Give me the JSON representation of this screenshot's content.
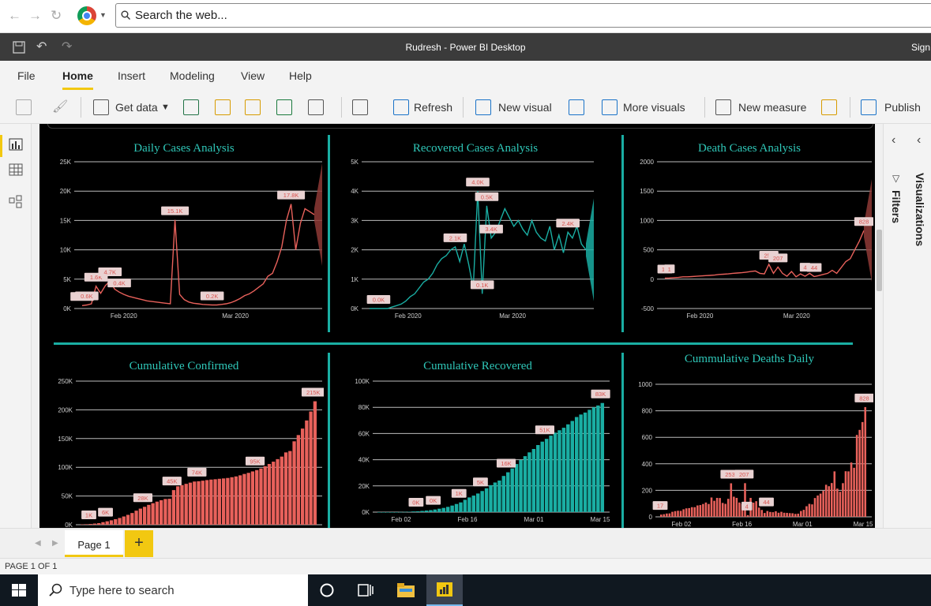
{
  "browser": {
    "search_placeholder": "Search the web..."
  },
  "window": {
    "title": "Rudresh - Power BI Desktop",
    "sign_in": "Sign"
  },
  "menu": [
    "File",
    "Home",
    "Insert",
    "Modeling",
    "View",
    "Help"
  ],
  "toolbar": {
    "get_data": "Get data",
    "refresh": "Refresh",
    "new_visual": "New visual",
    "more_visuals": "More visuals",
    "new_measure": "New measure",
    "publish": "Publish"
  },
  "panes": {
    "filters": "Filters",
    "visualizations": "Visualizations"
  },
  "pages": {
    "page1": "Page 1",
    "add": "+",
    "status": "PAGE 1 OF 1"
  },
  "taskbar": {
    "search": "Type here to search"
  },
  "colors": {
    "red": "#e8615b",
    "teal": "#1aaea3",
    "title": "#2fc7b8"
  },
  "chart_data": [
    {
      "type": "line",
      "title": "Daily Cases Analysis",
      "yticks": [
        "0K",
        "5K",
        "10K",
        "15K",
        "20K",
        "25K"
      ],
      "ylim": [
        0,
        25000
      ],
      "xticks": [
        "Feb 2020",
        "Mar 2020"
      ],
      "values": [
        500,
        600,
        800,
        3800,
        2600,
        3900,
        4700,
        3300,
        2800,
        2400,
        2100,
        1900,
        1700,
        1500,
        1300,
        1200,
        1100,
        1000,
        900,
        800,
        15100,
        2400,
        1500,
        1100,
        900,
        800,
        700,
        650,
        600,
        600,
        700,
        800,
        1000,
        1300,
        1700,
        2200,
        2500,
        3000,
        3600,
        4200,
        5500,
        6000,
        8000,
        10500,
        15000,
        17800,
        10000,
        14500,
        17000,
        16500,
        16000
      ],
      "labels": [
        "0.6K",
        "0.6K",
        "1.6K",
        "4.7K",
        "15.1K",
        "0.4K",
        "0.2K",
        "17.8K"
      ],
      "color": "#e8615b"
    },
    {
      "type": "line",
      "title": "Recovered Cases Analysis",
      "yticks": [
        "0K",
        "1K",
        "2K",
        "3K",
        "4K",
        "5K"
      ],
      "ylim": [
        0,
        5000
      ],
      "xticks": [
        "Feb 2020",
        "Mar 2020"
      ],
      "values": [
        0,
        0,
        0,
        0,
        0,
        50,
        100,
        150,
        250,
        400,
        500,
        700,
        900,
        1000,
        1200,
        1500,
        1700,
        1800,
        2000,
        2100,
        1600,
        2200,
        1500,
        700,
        4000,
        500,
        3500,
        2400,
        2600,
        3000,
        3400,
        3100,
        2800,
        3000,
        2700,
        2500,
        3000,
        2600,
        2400,
        2300,
        2800,
        2000,
        2500,
        1900,
        2600,
        2400,
        2800,
        2200,
        2000
      ],
      "labels": [
        "0.0K",
        "2.1K",
        "4.0K",
        "3.4K",
        "0.1K",
        "0.5K",
        "2.4K"
      ],
      "color": "#1aaea3"
    },
    {
      "type": "line",
      "title": "Death Cases Analysis",
      "yticks": [
        "-500",
        "0",
        "500",
        "1000",
        "1500",
        "2000"
      ],
      "ylim": [
        -500,
        2000
      ],
      "xticks": [
        "Feb 2020",
        "Mar 2020"
      ],
      "values": [
        17,
        20,
        25,
        30,
        40,
        40,
        45,
        50,
        55,
        60,
        65,
        70,
        80,
        85,
        90,
        100,
        105,
        110,
        120,
        130,
        140,
        100,
        90,
        253,
        100,
        207,
        100,
        50,
        130,
        40,
        90,
        50,
        100,
        44,
        60,
        80,
        100,
        150,
        100,
        200,
        300,
        350,
        500,
        650,
        828
      ],
      "labels": [
        "17",
        "1",
        "253",
        "207",
        "4",
        "44",
        "828"
      ],
      "color": "#e8615b"
    },
    {
      "type": "bar",
      "title": "Cumulative Confirmed",
      "yticks": [
        "0K",
        "50K",
        "100K",
        "150K",
        "200K",
        "250K"
      ],
      "ylim": [
        0,
        250000
      ],
      "values": [
        600,
        900,
        1300,
        2000,
        2800,
        4500,
        6000,
        7700,
        9700,
        11800,
        14400,
        17200,
        20400,
        24500,
        28100,
        31200,
        34600,
        37500,
        40200,
        42700,
        44800,
        45200,
        60300,
        66900,
        69000,
        71200,
        73300,
        75200,
        75700,
        76700,
        77700,
        78600,
        79200,
        80000,
        80600,
        81400,
        82700,
        84100,
        86000,
        88400,
        90300,
        92800,
        95100,
        97900,
        101800,
        105800,
        109800,
        114200,
        118600,
        125900,
        128300,
        145200,
        156100,
        167400,
        181500,
        197100,
        214900
      ],
      "labels": [
        "1K",
        "6K",
        "28K",
        "45K",
        "74K",
        "95K",
        "215K"
      ],
      "color": "#e8615b"
    },
    {
      "type": "bar",
      "title": "Cumulative Recovered",
      "yticks": [
        "0K",
        "20K",
        "40K",
        "60K",
        "80K",
        "100K"
      ],
      "ylim": [
        0,
        100000
      ],
      "xticks": [
        "Feb 02",
        "Feb 16",
        "Mar 01",
        "Mar 15"
      ],
      "values": [
        0,
        0,
        0,
        0,
        0,
        100,
        200,
        300,
        500,
        600,
        900,
        1200,
        1500,
        2000,
        2600,
        3200,
        4000,
        5000,
        6200,
        7400,
        9400,
        11200,
        12600,
        14200,
        16100,
        18200,
        20600,
        22600,
        24100,
        27600,
        30400,
        33300,
        36700,
        39800,
        42700,
        45600,
        48200,
        51200,
        53800,
        55900,
        58400,
        60700,
        62500,
        64400,
        67000,
        69600,
        72600,
        74500,
        76000,
        78100,
        80000,
        81400,
        83300
      ],
      "labels": [
        "0K",
        "0K",
        "1K",
        "5K",
        "16K",
        "51K",
        "83K"
      ],
      "color": "#1aaea3"
    },
    {
      "type": "bar",
      "title": "Cummulative Deaths Daily",
      "yticks": [
        "0",
        "200",
        "400",
        "600",
        "800",
        "1000"
      ],
      "ylim": [
        0,
        1000
      ],
      "xticks": [
        "Feb 02",
        "Feb 16",
        "Mar 01",
        "Mar 15"
      ],
      "values": [
        17,
        20,
        25,
        26,
        38,
        43,
        46,
        45,
        57,
        64,
        66,
        73,
        73,
        86,
        89,
        97,
        108,
        97,
        146,
        121,
        143,
        142,
        105,
        98,
        136,
        253,
        152,
        143,
        108,
        97,
        254,
        13,
        143,
        107,
        118,
        70,
        52,
        29,
        44,
        37,
        35,
        42,
        31,
        38,
        31,
        30,
        28,
        27,
        22,
        24,
        44,
        53,
        80,
        98,
        94,
        142,
        161,
        175,
        196,
        242,
        231,
        255,
        343,
        213,
        189,
        254,
        344,
        343,
        410,
        370,
        618,
        656,
        715,
        828
      ],
      "labels": [
        "17",
        "253",
        "207",
        "4",
        "44",
        "828"
      ],
      "color": "#e8615b"
    }
  ]
}
